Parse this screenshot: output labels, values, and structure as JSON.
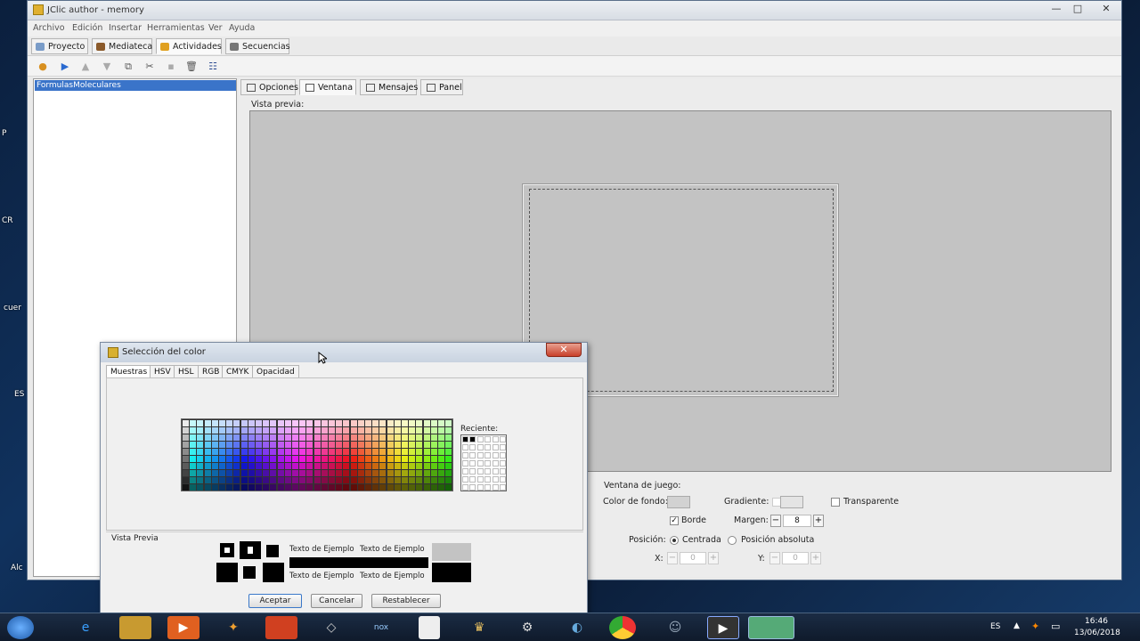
{
  "desktop": {
    "fragments": [
      "P",
      "CR",
      "cuer",
      "ES",
      "Alc"
    ]
  },
  "window": {
    "title": "JClic author - memory",
    "controls": {
      "minimize": "—",
      "maximize": "□",
      "close": "✕"
    },
    "menu": [
      "Archivo",
      "Edición",
      "Insertar",
      "Herramientas",
      "Ver",
      "Ayuda"
    ],
    "main_tabs": [
      {
        "label": "Proyecto",
        "icon": "project-icon"
      },
      {
        "label": "Mediateca",
        "icon": "media-icon"
      },
      {
        "label": "Actividades",
        "icon": "activities-icon",
        "selected": true
      },
      {
        "label": "Secuencias",
        "icon": "sequences-icon"
      }
    ],
    "toolbar": [
      "new-activity-icon",
      "play-icon",
      "move-up-icon",
      "move-down-icon",
      "copy-icon",
      "cut-icon",
      "paste-icon",
      "delete-icon",
      "tree-icon"
    ],
    "activity_list": [
      "FormulasMoleculares"
    ],
    "sub_tabs": [
      {
        "label": "Opciones"
      },
      {
        "label": "Ventana",
        "selected": true
      },
      {
        "label": "Mensajes"
      },
      {
        "label": "Panel"
      }
    ],
    "preview_label": "Vista previa:",
    "game_window": {
      "section_label": "Ventana de juego:",
      "bg_color_label": "Color de fondo:",
      "gradient_label": "Gradiente:",
      "transparent_label": "Transparente",
      "border_label": "Borde",
      "margin_label": "Margen:",
      "margin_value": "8",
      "position_label": "Posición:",
      "centered_label": "Centrada",
      "absolute_label": "Posición absoluta",
      "x_label": "X:",
      "x_value": "0",
      "y_label": "Y:",
      "y_value": "0"
    }
  },
  "color_dialog": {
    "title": "Selección del color",
    "close": "✕",
    "tabs": [
      "Muestras",
      "HSV",
      "HSL",
      "RGB",
      "CMYK",
      "Opacidad"
    ],
    "recent_label": "Reciente:",
    "preview_label": "Vista Previa",
    "sample_text": "Texto de Ejemplo",
    "buttons": {
      "accept": "Aceptar",
      "cancel": "Cancelar",
      "reset": "Restablecer"
    }
  },
  "taskbar": {
    "apps": [
      "start-icon",
      "ie-icon",
      "explorer-icon",
      "media-icon",
      "app-icon",
      "office-icon",
      "tool-icon",
      "nox-icon",
      "doc-icon",
      "game-icon",
      "steam-icon",
      "edge-icon",
      "chrome-icon",
      "discord-icon",
      "media-player-icon",
      "jclic-icon"
    ],
    "lang": "ES",
    "time": "16:46",
    "date": "13/06/2018"
  },
  "colors": {
    "accent": "#3a74c9",
    "preview_bg": "#c3c3c3",
    "dialog_close": "#c8402a"
  }
}
